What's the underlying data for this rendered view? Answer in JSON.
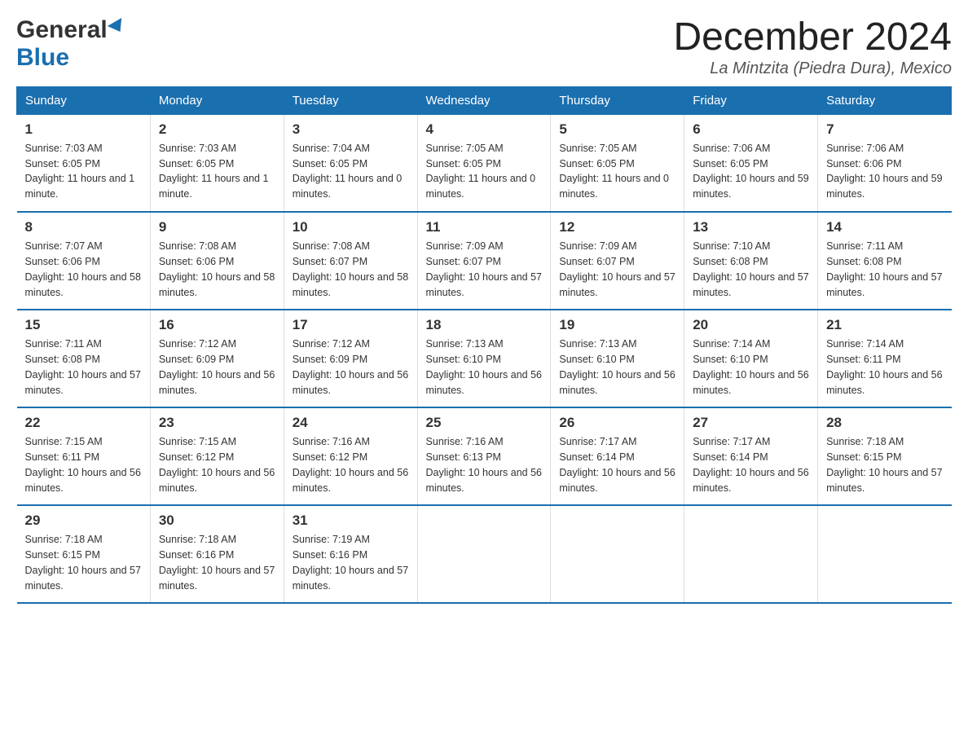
{
  "logo": {
    "general": "General",
    "blue": "Blue",
    "alt": "GeneralBlue logo"
  },
  "header": {
    "month_year": "December 2024",
    "location": "La Mintzita (Piedra Dura), Mexico"
  },
  "weekdays": [
    "Sunday",
    "Monday",
    "Tuesday",
    "Wednesday",
    "Thursday",
    "Friday",
    "Saturday"
  ],
  "weeks": [
    [
      {
        "day": "1",
        "sunrise": "7:03 AM",
        "sunset": "6:05 PM",
        "daylight": "11 hours and 1 minute."
      },
      {
        "day": "2",
        "sunrise": "7:03 AM",
        "sunset": "6:05 PM",
        "daylight": "11 hours and 1 minute."
      },
      {
        "day": "3",
        "sunrise": "7:04 AM",
        "sunset": "6:05 PM",
        "daylight": "11 hours and 0 minutes."
      },
      {
        "day": "4",
        "sunrise": "7:05 AM",
        "sunset": "6:05 PM",
        "daylight": "11 hours and 0 minutes."
      },
      {
        "day": "5",
        "sunrise": "7:05 AM",
        "sunset": "6:05 PM",
        "daylight": "11 hours and 0 minutes."
      },
      {
        "day": "6",
        "sunrise": "7:06 AM",
        "sunset": "6:05 PM",
        "daylight": "10 hours and 59 minutes."
      },
      {
        "day": "7",
        "sunrise": "7:06 AM",
        "sunset": "6:06 PM",
        "daylight": "10 hours and 59 minutes."
      }
    ],
    [
      {
        "day": "8",
        "sunrise": "7:07 AM",
        "sunset": "6:06 PM",
        "daylight": "10 hours and 58 minutes."
      },
      {
        "day": "9",
        "sunrise": "7:08 AM",
        "sunset": "6:06 PM",
        "daylight": "10 hours and 58 minutes."
      },
      {
        "day": "10",
        "sunrise": "7:08 AM",
        "sunset": "6:07 PM",
        "daylight": "10 hours and 58 minutes."
      },
      {
        "day": "11",
        "sunrise": "7:09 AM",
        "sunset": "6:07 PM",
        "daylight": "10 hours and 57 minutes."
      },
      {
        "day": "12",
        "sunrise": "7:09 AM",
        "sunset": "6:07 PM",
        "daylight": "10 hours and 57 minutes."
      },
      {
        "day": "13",
        "sunrise": "7:10 AM",
        "sunset": "6:08 PM",
        "daylight": "10 hours and 57 minutes."
      },
      {
        "day": "14",
        "sunrise": "7:11 AM",
        "sunset": "6:08 PM",
        "daylight": "10 hours and 57 minutes."
      }
    ],
    [
      {
        "day": "15",
        "sunrise": "7:11 AM",
        "sunset": "6:08 PM",
        "daylight": "10 hours and 57 minutes."
      },
      {
        "day": "16",
        "sunrise": "7:12 AM",
        "sunset": "6:09 PM",
        "daylight": "10 hours and 56 minutes."
      },
      {
        "day": "17",
        "sunrise": "7:12 AM",
        "sunset": "6:09 PM",
        "daylight": "10 hours and 56 minutes."
      },
      {
        "day": "18",
        "sunrise": "7:13 AM",
        "sunset": "6:10 PM",
        "daylight": "10 hours and 56 minutes."
      },
      {
        "day": "19",
        "sunrise": "7:13 AM",
        "sunset": "6:10 PM",
        "daylight": "10 hours and 56 minutes."
      },
      {
        "day": "20",
        "sunrise": "7:14 AM",
        "sunset": "6:10 PM",
        "daylight": "10 hours and 56 minutes."
      },
      {
        "day": "21",
        "sunrise": "7:14 AM",
        "sunset": "6:11 PM",
        "daylight": "10 hours and 56 minutes."
      }
    ],
    [
      {
        "day": "22",
        "sunrise": "7:15 AM",
        "sunset": "6:11 PM",
        "daylight": "10 hours and 56 minutes."
      },
      {
        "day": "23",
        "sunrise": "7:15 AM",
        "sunset": "6:12 PM",
        "daylight": "10 hours and 56 minutes."
      },
      {
        "day": "24",
        "sunrise": "7:16 AM",
        "sunset": "6:12 PM",
        "daylight": "10 hours and 56 minutes."
      },
      {
        "day": "25",
        "sunrise": "7:16 AM",
        "sunset": "6:13 PM",
        "daylight": "10 hours and 56 minutes."
      },
      {
        "day": "26",
        "sunrise": "7:17 AM",
        "sunset": "6:14 PM",
        "daylight": "10 hours and 56 minutes."
      },
      {
        "day": "27",
        "sunrise": "7:17 AM",
        "sunset": "6:14 PM",
        "daylight": "10 hours and 56 minutes."
      },
      {
        "day": "28",
        "sunrise": "7:18 AM",
        "sunset": "6:15 PM",
        "daylight": "10 hours and 57 minutes."
      }
    ],
    [
      {
        "day": "29",
        "sunrise": "7:18 AM",
        "sunset": "6:15 PM",
        "daylight": "10 hours and 57 minutes."
      },
      {
        "day": "30",
        "sunrise": "7:18 AM",
        "sunset": "6:16 PM",
        "daylight": "10 hours and 57 minutes."
      },
      {
        "day": "31",
        "sunrise": "7:19 AM",
        "sunset": "6:16 PM",
        "daylight": "10 hours and 57 minutes."
      },
      null,
      null,
      null,
      null
    ]
  ],
  "labels": {
    "sunrise": "Sunrise:",
    "sunset": "Sunset:",
    "daylight": "Daylight:"
  }
}
